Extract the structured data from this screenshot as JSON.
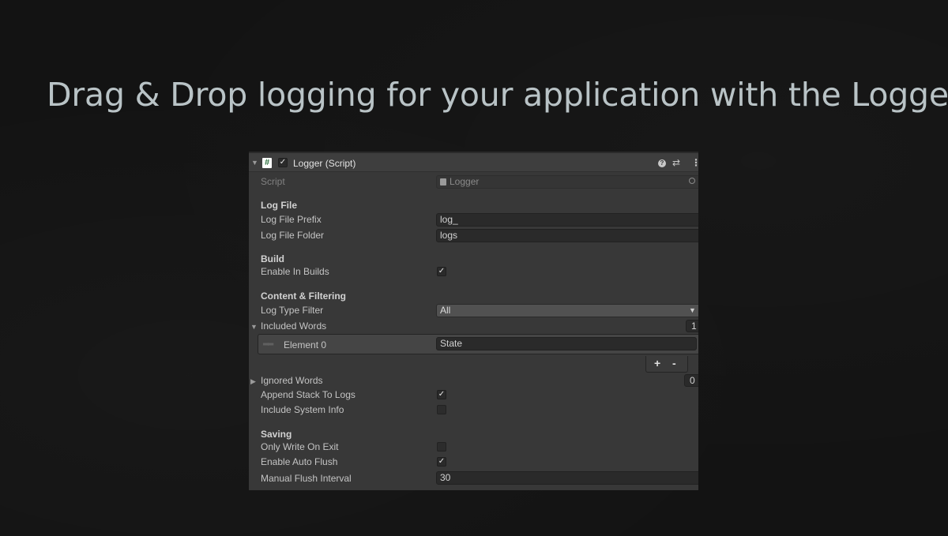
{
  "headline": "Drag & Drop logging for your application with the Logger:",
  "component": {
    "title": "Logger (Script)",
    "enabled": true,
    "icons": [
      "hash-script-icon",
      "help-icon",
      "preset-icon",
      "kebab-menu-icon"
    ]
  },
  "script": {
    "label": "Script",
    "value": "Logger"
  },
  "log_file": {
    "section": "Log File",
    "prefix_label": "Log File Prefix",
    "prefix_value": "log_",
    "folder_label": "Log File Folder",
    "folder_value": "logs"
  },
  "build": {
    "section": "Build",
    "enable_label": "Enable In Builds",
    "enable_checked": true
  },
  "content": {
    "section": "Content & Filtering",
    "type_filter_label": "Log Type Filter",
    "type_filter_value": "All",
    "included_label": "Included Words",
    "included_count": "1",
    "element_label": "Element 0",
    "element_value": "State",
    "add_label": "+",
    "remove_label": "-",
    "ignored_label": "Ignored Words",
    "ignored_count": "0",
    "append_label": "Append Stack To Logs",
    "append_checked": true,
    "sysinfo_label": "Include System Info",
    "sysinfo_checked": false
  },
  "saving": {
    "section": "Saving",
    "only_exit_label": "Only Write On Exit",
    "only_exit_checked": false,
    "auto_flush_label": "Enable Auto Flush",
    "auto_flush_checked": true,
    "interval_label": "Manual Flush Interval",
    "interval_value": "30"
  },
  "colors": {
    "page_bg": "#131313",
    "headline": "#b9c3c6",
    "panel_bg": "#383838",
    "field_bg": "#2a2a2a"
  }
}
